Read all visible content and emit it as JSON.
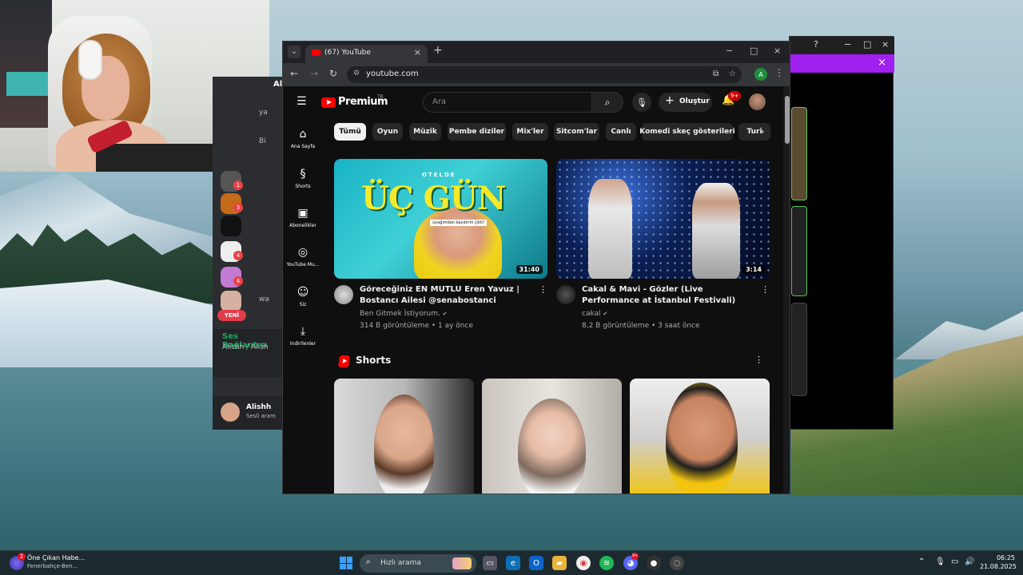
{
  "browser": {
    "tab_title": "(67) YouTube",
    "url": "youtube.com",
    "profile_initial": "A",
    "new_tab": "+",
    "tab_close": "×"
  },
  "youtube": {
    "logo_text": "Premium",
    "logo_region": "TR",
    "search_placeholder": "Ara",
    "create_label": "Oluştur",
    "notifications_badge": "9+",
    "guide": [
      {
        "label": "Ana Sayfa",
        "icon": "home-icon"
      },
      {
        "label": "Shorts",
        "icon": "shorts-icon"
      },
      {
        "label": "Abonelikler",
        "icon": "subscriptions-icon"
      },
      {
        "label": "YouTube Mu...",
        "icon": "youtube-music-icon"
      },
      {
        "label": "Siz",
        "icon": "you-icon"
      },
      {
        "label": "İndirilenler",
        "icon": "downloads-icon"
      }
    ],
    "chips": [
      "Tümü",
      "Oyun",
      "Müzik",
      "Pembe diziler",
      "Mix'ler",
      "Sitcom'lar",
      "Canlı",
      "Komedi skeç gösterileri",
      "Turi"
    ],
    "active_chip": "Tümü",
    "videos": [
      {
        "thumb_title": "ÜÇ GÜN",
        "thumb_over": "OTELDE",
        "thumb_sub": "uyağımdan kaydırım çıktı!",
        "duration": "31:40",
        "title": "Göreceğiniz EN MUTLU Eren Yavuz | Bostancı Ailesi @senabostanci",
        "channel": "Ben Gitmek İstiyorum.",
        "meta": "314 B görüntüleme • 1 ay önce"
      },
      {
        "duration": "3:14",
        "title": "Cakal & Mavi - Gözler (Live Performance at İstanbul Festivali)",
        "channel": "cakal",
        "meta": "8,2 B görüntüleme • 3 saat önce"
      }
    ],
    "shorts_title": "Shorts"
  },
  "discord": {
    "server_badges": [
      "1",
      "3",
      "4",
      "4"
    ],
    "new_label": "YENİ",
    "voice_title": "Ses Bağlantısı",
    "voice_sub": "Alishh / Alish",
    "user_name": "Alishh",
    "user_status": "Sesli aram",
    "top_label": "Al",
    "channel_snippets": [
      "ya",
      "Bi",
      "wa"
    ]
  },
  "taskbar": {
    "news_title": "Öne Çıkan Habe...",
    "news_sub": "Fenerbahçe-Ben...",
    "news_badge": "2",
    "search_text": "Hızlı arama",
    "discord_badge": "9+",
    "time": "06:25",
    "date": "21.08.2025"
  },
  "colors": {
    "youtube_red": "#ff0000",
    "purple_bar": "#a020f0",
    "discord_bg": "#2b2d31",
    "chrome_tab": "#35363a"
  }
}
